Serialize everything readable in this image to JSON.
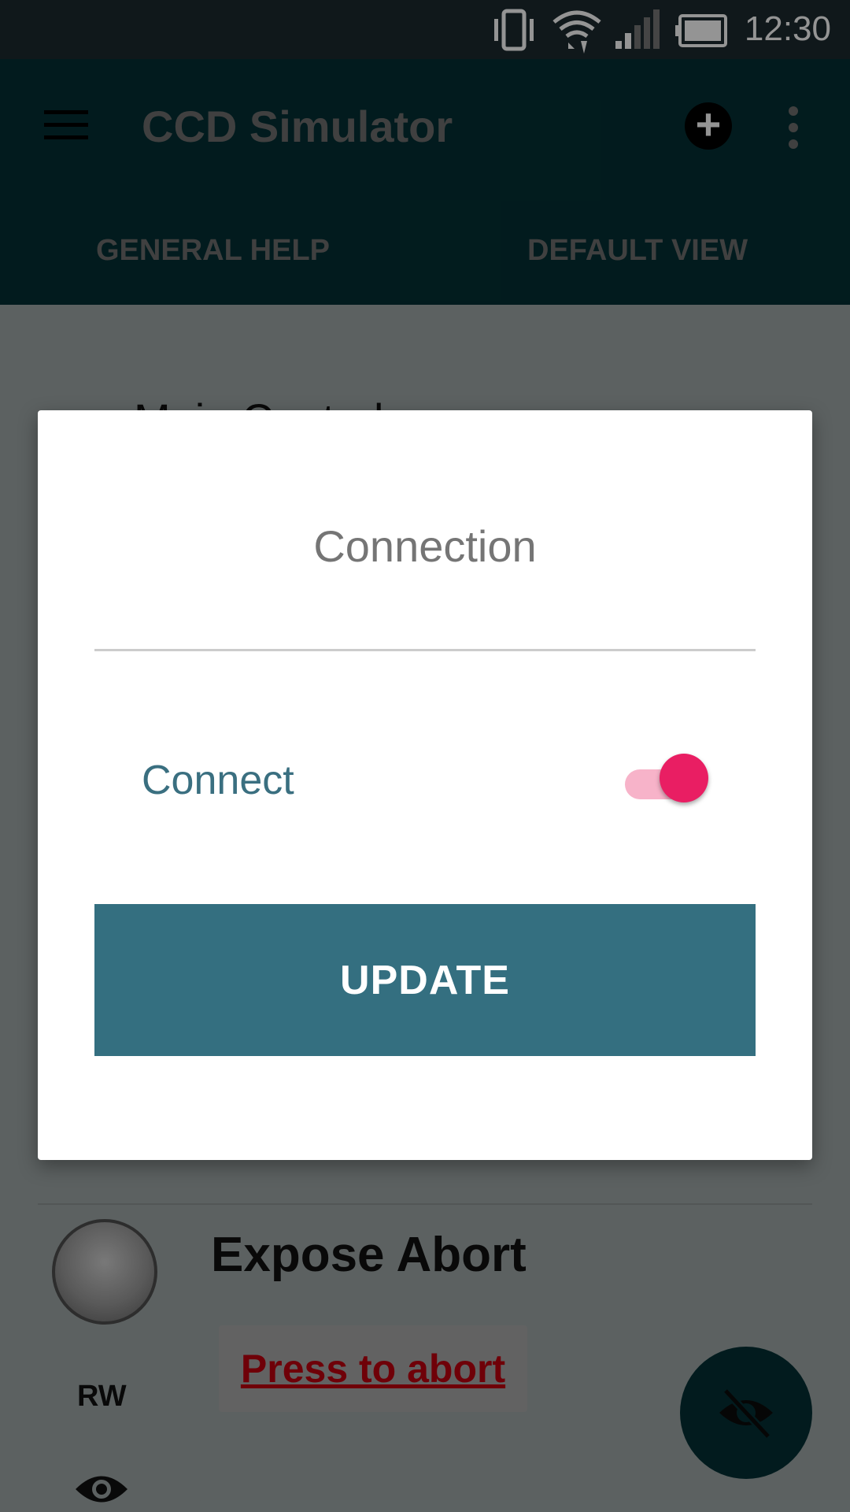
{
  "status_bar": {
    "time": "12:30",
    "icons": [
      "vibrate-icon",
      "wifi-icon",
      "signal-icon",
      "battery-icon"
    ]
  },
  "app_bar": {
    "title": "CCD Simulator",
    "actions": [
      "menu-icon",
      "add-circle-icon",
      "more-vert-icon"
    ],
    "tabs": [
      {
        "label": "GENERAL HELP"
      },
      {
        "label": "DEFAULT VIEW"
      }
    ]
  },
  "background": {
    "section_heading": "Main Control",
    "property": {
      "label": "Expose Abort",
      "permission": "RW",
      "button_label": "Press to abort"
    },
    "fab_icon": "visibility-off-icon"
  },
  "dialog": {
    "title": "Connection",
    "switch": {
      "label": "Connect",
      "checked": true
    },
    "update_label": "UPDATE"
  },
  "colors": {
    "app_bar": "#043034",
    "status_bar": "#1c2a30",
    "accent": "#e91e63",
    "button": "#346f80",
    "abort_text": "#c0000e"
  }
}
